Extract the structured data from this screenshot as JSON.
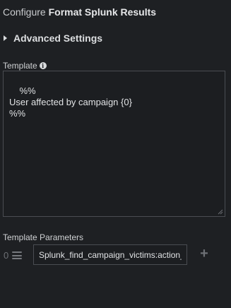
{
  "header": {
    "prefix": "Configure",
    "title": "Format Splunk Results"
  },
  "advanced": {
    "label": "Advanced Settings",
    "expanded": false
  },
  "template": {
    "label": "Template",
    "icon": "info-icon",
    "value": "%%\nUser affected by campaign {0}\n%%"
  },
  "parameters": {
    "label": "Template Parameters",
    "items": [
      {
        "index": "0",
        "value": "Splunk_find_campaign_victims:action_result.data.*.user"
      }
    ],
    "add_icon": "plus-icon",
    "drag_icon": "drag-handle-icon"
  },
  "colors": {
    "background": "#1e2023",
    "border": "#4a4d52",
    "text": "#d6d8da"
  }
}
